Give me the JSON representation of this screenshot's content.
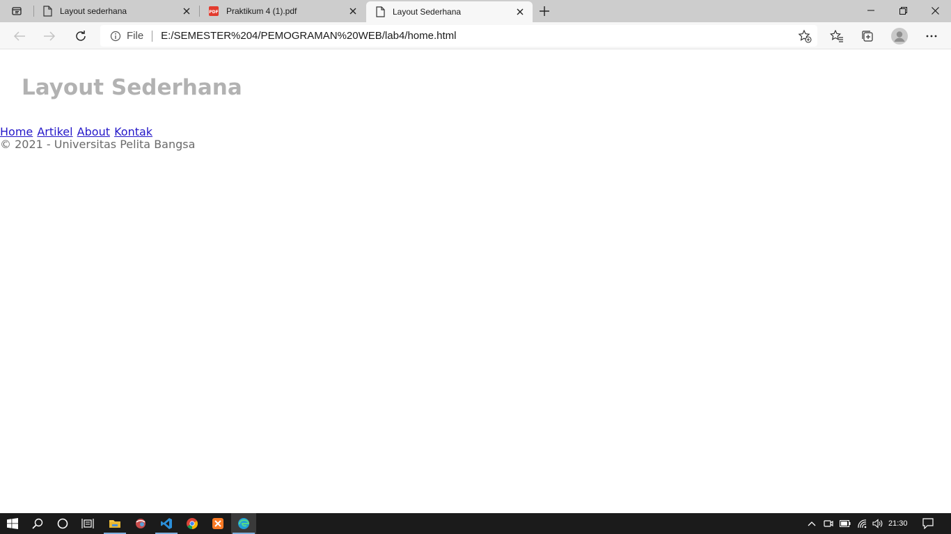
{
  "browser": {
    "tabs": [
      {
        "title": "Layout sederhana",
        "active": false,
        "icon": "page-icon"
      },
      {
        "title": "Praktikum 4 (1).pdf",
        "active": false,
        "icon": "pdf-icon"
      },
      {
        "title": "Layout Sederhana",
        "active": true,
        "icon": "page-icon"
      }
    ],
    "address": {
      "scheme_label": "File",
      "url": "E:/SEMESTER%204/PEMOGRAMAN%20WEB/lab4/home.html"
    }
  },
  "page": {
    "heading": "Layout Sederhana",
    "nav": [
      "Home",
      "Artikel",
      "About",
      "Kontak"
    ],
    "footer": "© 2021 - Universitas Pelita Bangsa"
  },
  "taskbar": {
    "time": "21:30",
    "apps": [
      "start-icon",
      "search-icon",
      "cortana-icon",
      "task-view-icon",
      "file-explorer-icon",
      "app-icon",
      "vscode-icon",
      "chrome-icon",
      "xampp-icon",
      "edge-icon"
    ]
  },
  "colors": {
    "heading": "#b2b2b2",
    "link": "#2417c8",
    "footer_text": "#6a6a6a",
    "tabstrip": "#cdcdcd",
    "taskbar": "#1b1b1b"
  }
}
